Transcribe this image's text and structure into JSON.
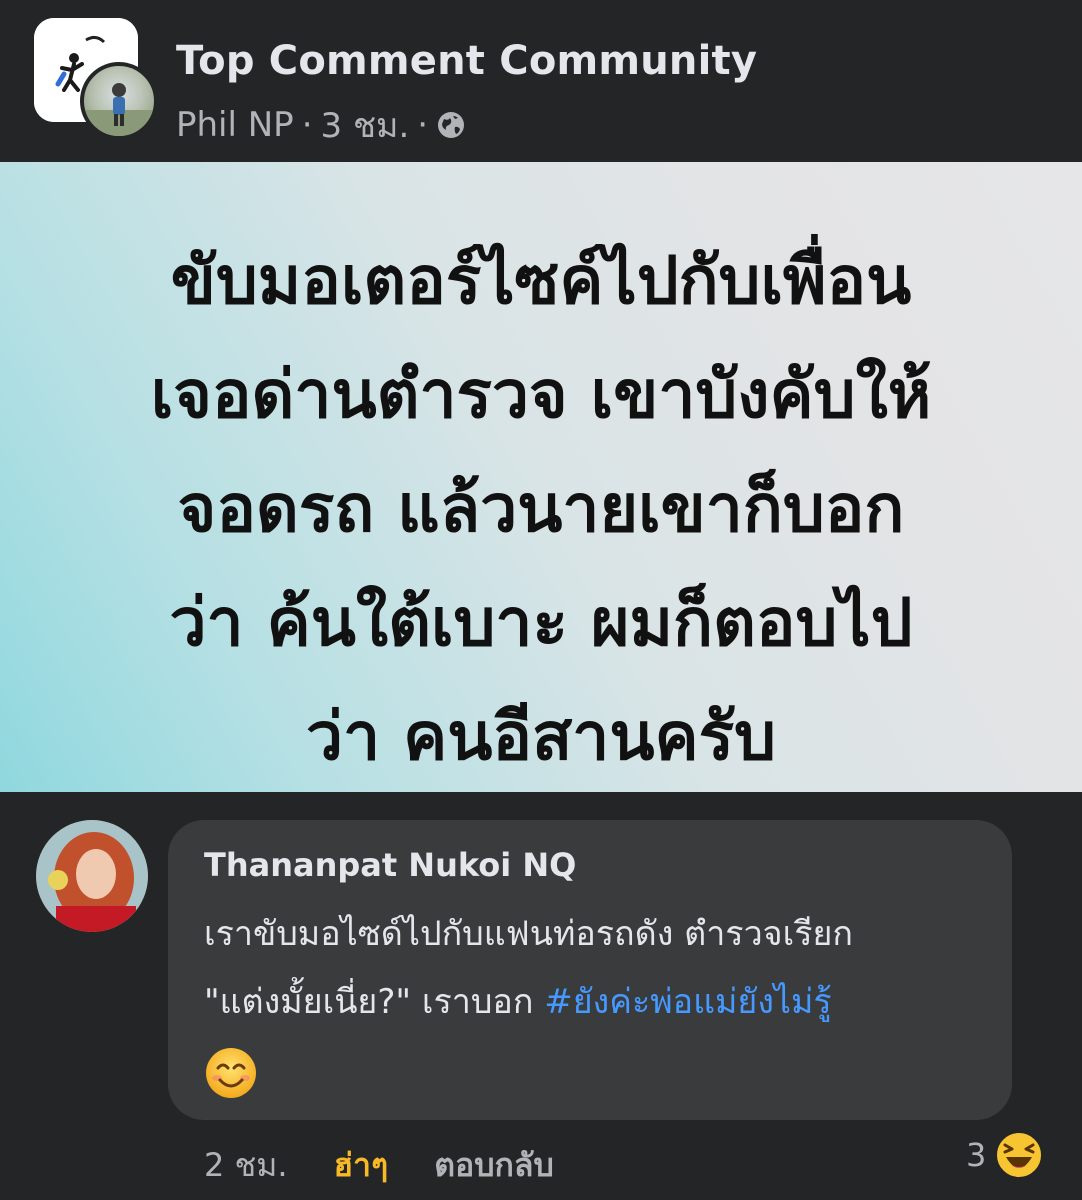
{
  "post": {
    "group_name": "Top Comment Community",
    "author": "Phil NP",
    "time": "3 ชม.",
    "separator": "·",
    "image_lines": [
      "ขับมอเตอร์ไซค์ไปกับเพื่อน",
      "เจอด่านตำรวจ เขาบังคับให้",
      "จอดรถ แล้วนายเขาก็บอก",
      "ว่า ค้นใต้เบาะ ผมก็ตอบไป",
      "ว่า คนอีสานครับ"
    ]
  },
  "comment": {
    "name": "Thananpat Nukoi NQ",
    "line1": "เราขับมอไซด์ไปกับแฟนท่อรถดัง ตำรวจเรียก",
    "line2_text": "\"แต่งมั้ยเนี่ย?\" เราบอก ",
    "hashtag": "#ยังค่ะพ่อแม่ยังไม่รู้",
    "emoji": "smiling-face-emoji",
    "time": "2 ชม.",
    "like_label": "ฮ่าๆ",
    "reply_label": "ตอบกลับ",
    "reaction_count": "3",
    "reaction": "laughing-emoji"
  },
  "colors": {
    "background": "#242526",
    "bubble": "#3a3b3c",
    "hashtag": "#4599ff",
    "like_active": "#f7b928",
    "secondary_text": "#b0b3b8"
  }
}
